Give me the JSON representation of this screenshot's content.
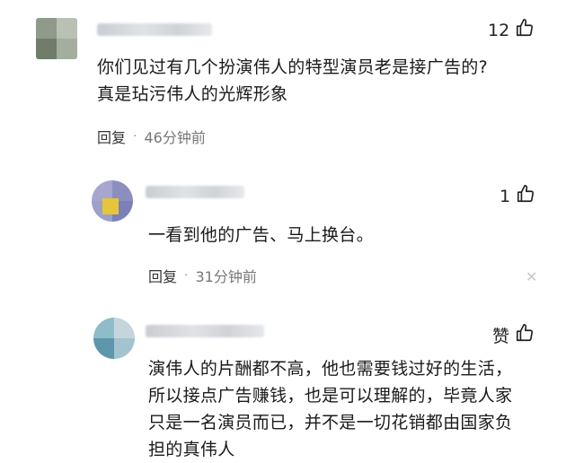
{
  "comments": [
    {
      "likes": "12",
      "text_lines": [
        "你们见过有几个扮演伟人的特型演员老是接广告的?",
        "真是玷污伟人的光辉形象"
      ],
      "reply_label": "回复",
      "time": "46分钟前"
    },
    {
      "likes": "1",
      "text_lines": [
        "一看到他的广告、马上换台。"
      ],
      "reply_label": "回复",
      "time": "31分钟前"
    },
    {
      "likes": "赞",
      "text_lines": [
        "演伟人的片酬都不高，他也需要钱过好的生活，",
        "所以接点广告赚钱，也是可以理解的，毕竟人家",
        "只是一名演员而已，并不是一切花销都由国家负",
        "担的真伟人"
      ]
    }
  ],
  "icons": {
    "like": "thumbs-up-icon",
    "close": "close-icon"
  },
  "colors": {
    "text": "#1a1a1a",
    "meta": "#777777",
    "background": "#ffffff"
  }
}
